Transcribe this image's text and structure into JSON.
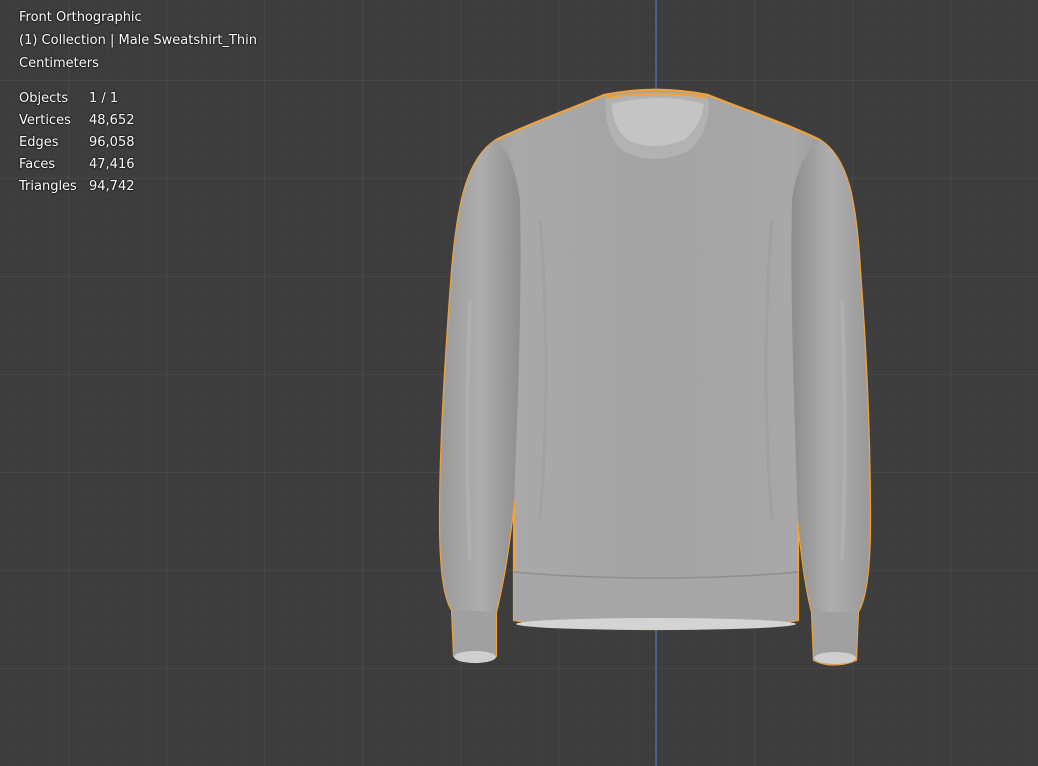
{
  "viewport": {
    "view_name": "Front Orthographic",
    "collection_info": "(1) Collection | Male Sweatshirt_Thin",
    "units": "Centimeters",
    "colors": {
      "background": "#3d3d3d",
      "grid_line": "#4a4a4a",
      "axis_z": "#4e6fa8",
      "selection_outline": "#f0a23c",
      "mesh": "#a6a6a6"
    }
  },
  "stats": [
    {
      "label": "Objects",
      "value": "1 / 1"
    },
    {
      "label": "Vertices",
      "value": "48,652"
    },
    {
      "label": "Edges",
      "value": "96,058"
    },
    {
      "label": "Faces",
      "value": "47,416"
    },
    {
      "label": "Triangles",
      "value": "94,742"
    }
  ]
}
